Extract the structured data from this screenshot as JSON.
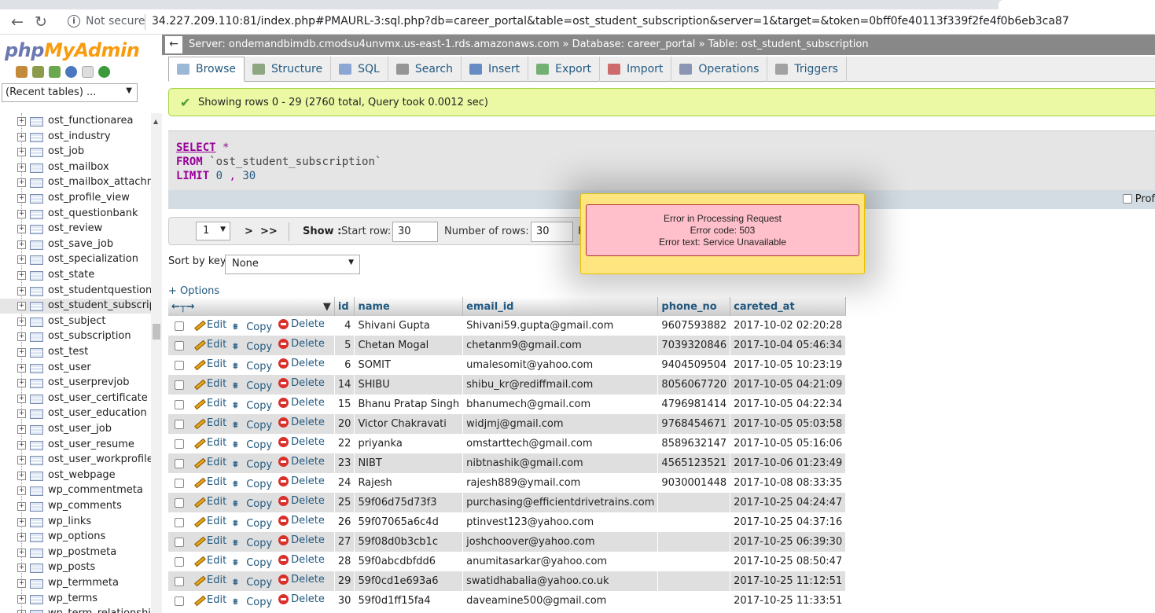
{
  "browser": {
    "security": "Not secure",
    "url": "34.227.209.110:81/index.php#PMAURL-3:sql.php?db=career_portal&table=ost_student_subscription&server=1&target=&token=0bff0fe40113f339f2fe4f0b6eb3ca87"
  },
  "sidebar": {
    "logo_part1": "php",
    "logo_part2": "MyAdmin",
    "recent_tables": "(Recent tables) ...",
    "tables": [
      "ost_functionarea",
      "ost_industry",
      "ost_job",
      "ost_mailbox",
      "ost_mailbox_attachme",
      "ost_profile_view",
      "ost_questionbank",
      "ost_review",
      "ost_save_job",
      "ost_specialization",
      "ost_state",
      "ost_studentquestion",
      "ost_student_subscripti",
      "ost_subject",
      "ost_subscription",
      "ost_test",
      "ost_user",
      "ost_userprevjob",
      "ost_user_certificate",
      "ost_user_education",
      "ost_user_job",
      "ost_user_resume",
      "ost_user_workprofile",
      "ost_webpage",
      "wp_commentmeta",
      "wp_comments",
      "wp_links",
      "wp_options",
      "wp_postmeta",
      "wp_posts",
      "wp_termmeta",
      "wp_terms",
      "wp_term_relationships"
    ],
    "active_index": 12
  },
  "breadcrumb": {
    "server": "Server: ondemandbimdb.cmodsu4unvmx.us-east-1.rds.amazonaws.com",
    "sep": "»",
    "database": "Database: career_portal",
    "table": "Table: ost_student_subscription"
  },
  "tabs": [
    "Browse",
    "Structure",
    "SQL",
    "Search",
    "Insert",
    "Export",
    "Import",
    "Operations",
    "Triggers"
  ],
  "success_message": "Showing rows 0 - 29 (2760 total, Query took 0.0012 sec)",
  "sql": {
    "select": "SELECT",
    "star": "*",
    "from": "FROM",
    "table": "`ost_student_subscription`",
    "limit": "LIMIT",
    "offset": "0",
    "comma": ",",
    "count": "30"
  },
  "profiling_label": "Prof",
  "navigation": {
    "page": "1",
    "next": ">",
    "last": ">>",
    "show_label": "Show :",
    "start_row_label": "Start row:",
    "start_row": "30",
    "num_rows_label": "Number of rows:",
    "num_rows": "30",
    "cut": "H"
  },
  "sort": {
    "label": "Sort by key:",
    "value": "None"
  },
  "options_link": "+ Options",
  "error": {
    "title": "Error in Processing Request",
    "code": "Error code: 503",
    "text": "Error text: Service Unavailable"
  },
  "table": {
    "columns": [
      "id",
      "name",
      "email_id",
      "phone_no",
      "careted_at"
    ],
    "actions": {
      "edit": "Edit",
      "copy": "Copy",
      "delete": "Delete"
    },
    "rows": [
      {
        "id": "4",
        "name": "Shivani Gupta",
        "email": "Shivani59.gupta@gmail.com",
        "phone": "9607593882",
        "created": "2017-10-02 02:20:28"
      },
      {
        "id": "5",
        "name": "Chetan Mogal",
        "email": "chetanm9@gmail.com",
        "phone": "7039320846",
        "created": "2017-10-04 05:46:34"
      },
      {
        "id": "6",
        "name": "SOMIT",
        "email": "umalesomit@yahoo.com",
        "phone": "9404509504",
        "created": "2017-10-05 10:23:19"
      },
      {
        "id": "14",
        "name": "SHIBU",
        "email": "shibu_kr@rediffmail.com",
        "phone": "8056067720",
        "created": "2017-10-05 04:21:09"
      },
      {
        "id": "15",
        "name": "Bhanu Pratap Singh",
        "email": "bhanumech@gmail.com",
        "phone": "4796981414",
        "created": "2017-10-05 04:22:34"
      },
      {
        "id": "20",
        "name": "Victor Chakravati",
        "email": "widjmj@gmail.com",
        "phone": "9768454671",
        "created": "2017-10-05 05:03:58"
      },
      {
        "id": "22",
        "name": "priyanka",
        "email": "omstarttech@gmail.com",
        "phone": "8589632147",
        "created": "2017-10-05 05:16:06"
      },
      {
        "id": "23",
        "name": "NIBT",
        "email": "nibtnashik@gmail.com",
        "phone": "4565123521",
        "created": "2017-10-06 01:23:49"
      },
      {
        "id": "24",
        "name": "Rajesh",
        "email": "rajesh889@ymail.com",
        "phone": "9030001448",
        "created": "2017-10-08 08:33:35"
      },
      {
        "id": "25",
        "name": "59f06d75d73f3",
        "email": "purchasing@efficientdrivetrains.com",
        "phone": "",
        "created": "2017-10-25 04:24:47"
      },
      {
        "id": "26",
        "name": "59f07065a6c4d",
        "email": "ptinvest123@yahoo.com",
        "phone": "",
        "created": "2017-10-25 04:37:16"
      },
      {
        "id": "27",
        "name": "59f08d0b3cb1c",
        "email": "joshchoover@yahoo.com",
        "phone": "",
        "created": "2017-10-25 06:39:30"
      },
      {
        "id": "28",
        "name": "59f0abcdbfdd6",
        "email": "anumitasarkar@yahoo.com",
        "phone": "",
        "created": "2017-10-25 08:50:47"
      },
      {
        "id": "29",
        "name": "59f0cd1e693a6",
        "email": "swatidhabalia@yahoo.co.uk",
        "phone": "",
        "created": "2017-10-25 11:12:51"
      },
      {
        "id": "30",
        "name": "59f0d1ff15fa4",
        "email": "daveamine500@gmail.com",
        "phone": "",
        "created": "2017-10-25 11:33:51"
      }
    ]
  },
  "colors": {
    "link": "#235a81",
    "success_bg": "#ebf8a4",
    "error_outer": "#ffe57f",
    "error_inner": "#ffc0cb"
  }
}
